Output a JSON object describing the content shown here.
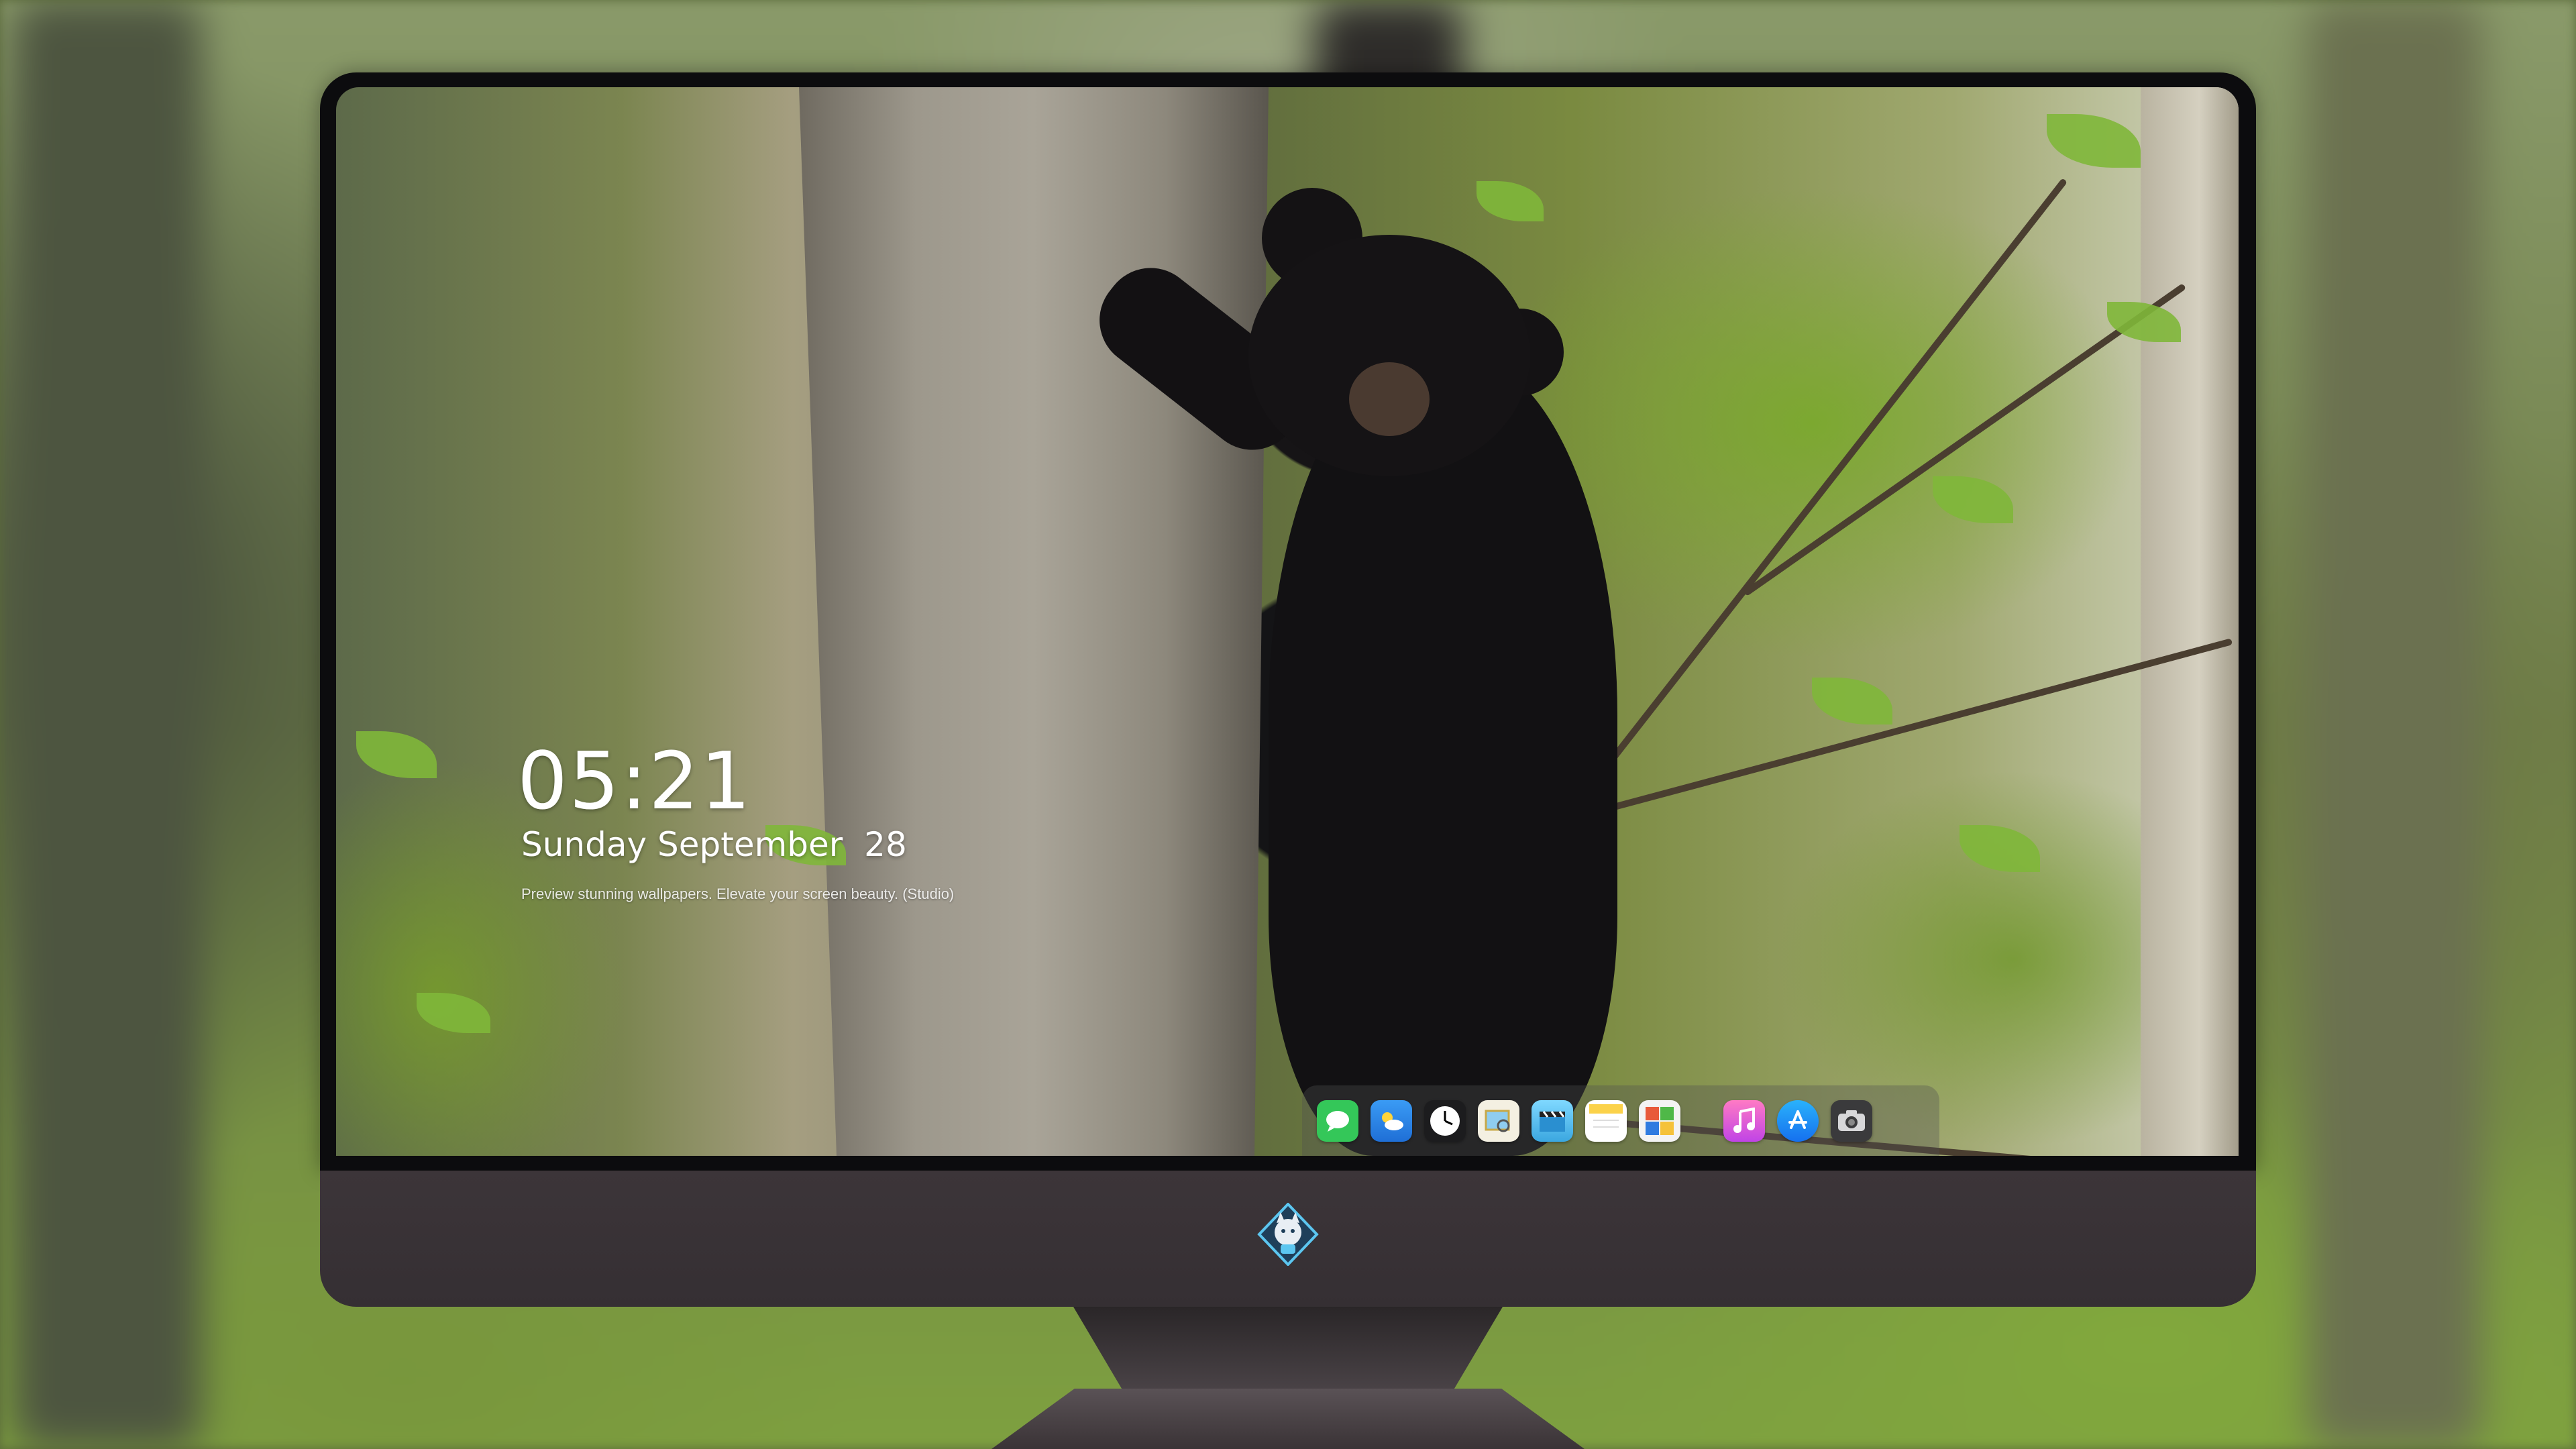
{
  "lock_screen": {
    "time": "05:21",
    "date": "Sunday September  28",
    "tagline": "Preview stunning wallpapers. Elevate your screen beauty. (Studio)"
  },
  "dock": {
    "apps": [
      {
        "name": "Messages",
        "icon": "messages-icon",
        "color": "#34c759"
      },
      {
        "name": "Weather",
        "icon": "weather-icon",
        "color": "#2f8cf0"
      },
      {
        "name": "Clock",
        "icon": "clock-icon",
        "color": "#f2f2f2"
      },
      {
        "name": "Preview",
        "icon": "preview-icon",
        "color": "#e8d070"
      },
      {
        "name": "Clips",
        "icon": "clips-icon",
        "color": "#5ac8fa"
      },
      {
        "name": "Notes",
        "icon": "notes-icon",
        "color": "#fbd24a"
      },
      {
        "name": "Photo Booth",
        "icon": "photo-booth-icon",
        "color": "#e85a3a"
      },
      {
        "name": "Music",
        "icon": "music-icon",
        "color": "#f55fa5"
      },
      {
        "name": "App Store",
        "icon": "app-store-icon",
        "color": "#1a8cf6"
      },
      {
        "name": "Camera",
        "icon": "camera-icon",
        "color": "#8e8e93"
      }
    ]
  },
  "colors": {
    "chin": "#3c3539",
    "bezel": "#0c0c0e",
    "dock_bg": "rgba(80,80,80,0.35)"
  }
}
